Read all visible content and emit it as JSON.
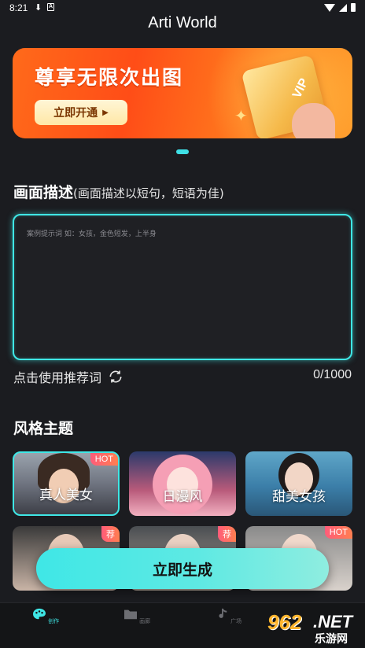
{
  "status_bar": {
    "time": "8:21"
  },
  "app": {
    "title": "Arti World"
  },
  "banner": {
    "headline": "尊享无限次出图",
    "button_label": "立即开通",
    "card_text": "VIP"
  },
  "prompt_section": {
    "title": "画面描述",
    "subtitle": "(画面描述以短句，短语为佳)",
    "placeholder": "案例提示词 如：女孩，金色短发，上半身",
    "recommend_label": "点击使用推荐词",
    "counter": "0/1000"
  },
  "style_section": {
    "title": "风格主题",
    "cards": [
      {
        "label": "真人美女",
        "badge": "HOT",
        "selected": true
      },
      {
        "label": "日漫风",
        "badge": "",
        "selected": false
      },
      {
        "label": "甜美女孩",
        "badge": "",
        "selected": false
      },
      {
        "label": "",
        "badge": "荐",
        "selected": false
      },
      {
        "label": "",
        "badge": "荐",
        "selected": false
      },
      {
        "label": "",
        "badge": "HOT",
        "selected": false
      }
    ]
  },
  "generate_button": {
    "label": "立即生成"
  },
  "bottom_nav": {
    "items": [
      {
        "label": "创作",
        "icon": "palette-icon",
        "active": true
      },
      {
        "label": "画廊",
        "icon": "folder-icon",
        "active": false
      },
      {
        "label": "广场",
        "icon": "music-note-icon",
        "active": false
      }
    ]
  },
  "watermark": {
    "number": "962",
    "suffix": ".NET",
    "text": "乐游网"
  },
  "colors": {
    "accent": "#3fe7e6",
    "background": "#1b1c20",
    "banner": "#ff5a1a"
  }
}
